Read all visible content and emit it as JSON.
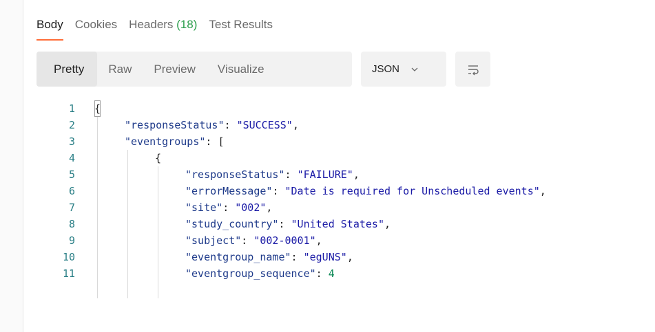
{
  "response_tabs": [
    {
      "label": "Body",
      "active": true
    },
    {
      "label": "Cookies",
      "active": false
    },
    {
      "label": "Headers",
      "count": "(18)",
      "active": false
    },
    {
      "label": "Test Results",
      "active": false
    }
  ],
  "view_modes": [
    {
      "label": "Pretty",
      "active": true
    },
    {
      "label": "Raw",
      "active": false
    },
    {
      "label": "Preview",
      "active": false
    },
    {
      "label": "Visualize",
      "active": false
    }
  ],
  "format": {
    "selected": "JSON",
    "icon": "chevron-down-icon"
  },
  "wrap_button": {
    "icon": "wrap-lines-icon"
  },
  "colors": {
    "accent": "#ff6c37",
    "count_green": "#2a9d4b",
    "line_number": "#2a7f86",
    "key": "#1e3a8a",
    "string": "#1a1aa6",
    "number": "#0a8754"
  },
  "code_lines": [
    {
      "n": "1",
      "indent": 0,
      "text": "{"
    },
    {
      "n": "2",
      "indent": 1,
      "key": "responseStatus",
      "value": "SUCCESS",
      "type": "string",
      "trail": ","
    },
    {
      "n": "3",
      "indent": 1,
      "key": "eventgroups",
      "raw": "[",
      "trail": ""
    },
    {
      "n": "4",
      "indent": 2,
      "text": "{"
    },
    {
      "n": "5",
      "indent": 3,
      "key": "responseStatus",
      "value": "FAILURE",
      "type": "string",
      "trail": ","
    },
    {
      "n": "6",
      "indent": 3,
      "key": "errorMessage",
      "value": "Date is required for Unscheduled events",
      "type": "string",
      "trail": ","
    },
    {
      "n": "7",
      "indent": 3,
      "key": "site",
      "value": "002",
      "type": "string",
      "trail": ","
    },
    {
      "n": "8",
      "indent": 3,
      "key": "study_country",
      "value": "United States",
      "type": "string",
      "trail": ","
    },
    {
      "n": "9",
      "indent": 3,
      "key": "subject",
      "value": "002-0001",
      "type": "string",
      "trail": ","
    },
    {
      "n": "10",
      "indent": 3,
      "key": "eventgroup_name",
      "value": "egUNS",
      "type": "string",
      "trail": ","
    },
    {
      "n": "11",
      "indent": 3,
      "key": "eventgroup_sequence",
      "value": "4",
      "type": "number",
      "trail": ""
    }
  ]
}
